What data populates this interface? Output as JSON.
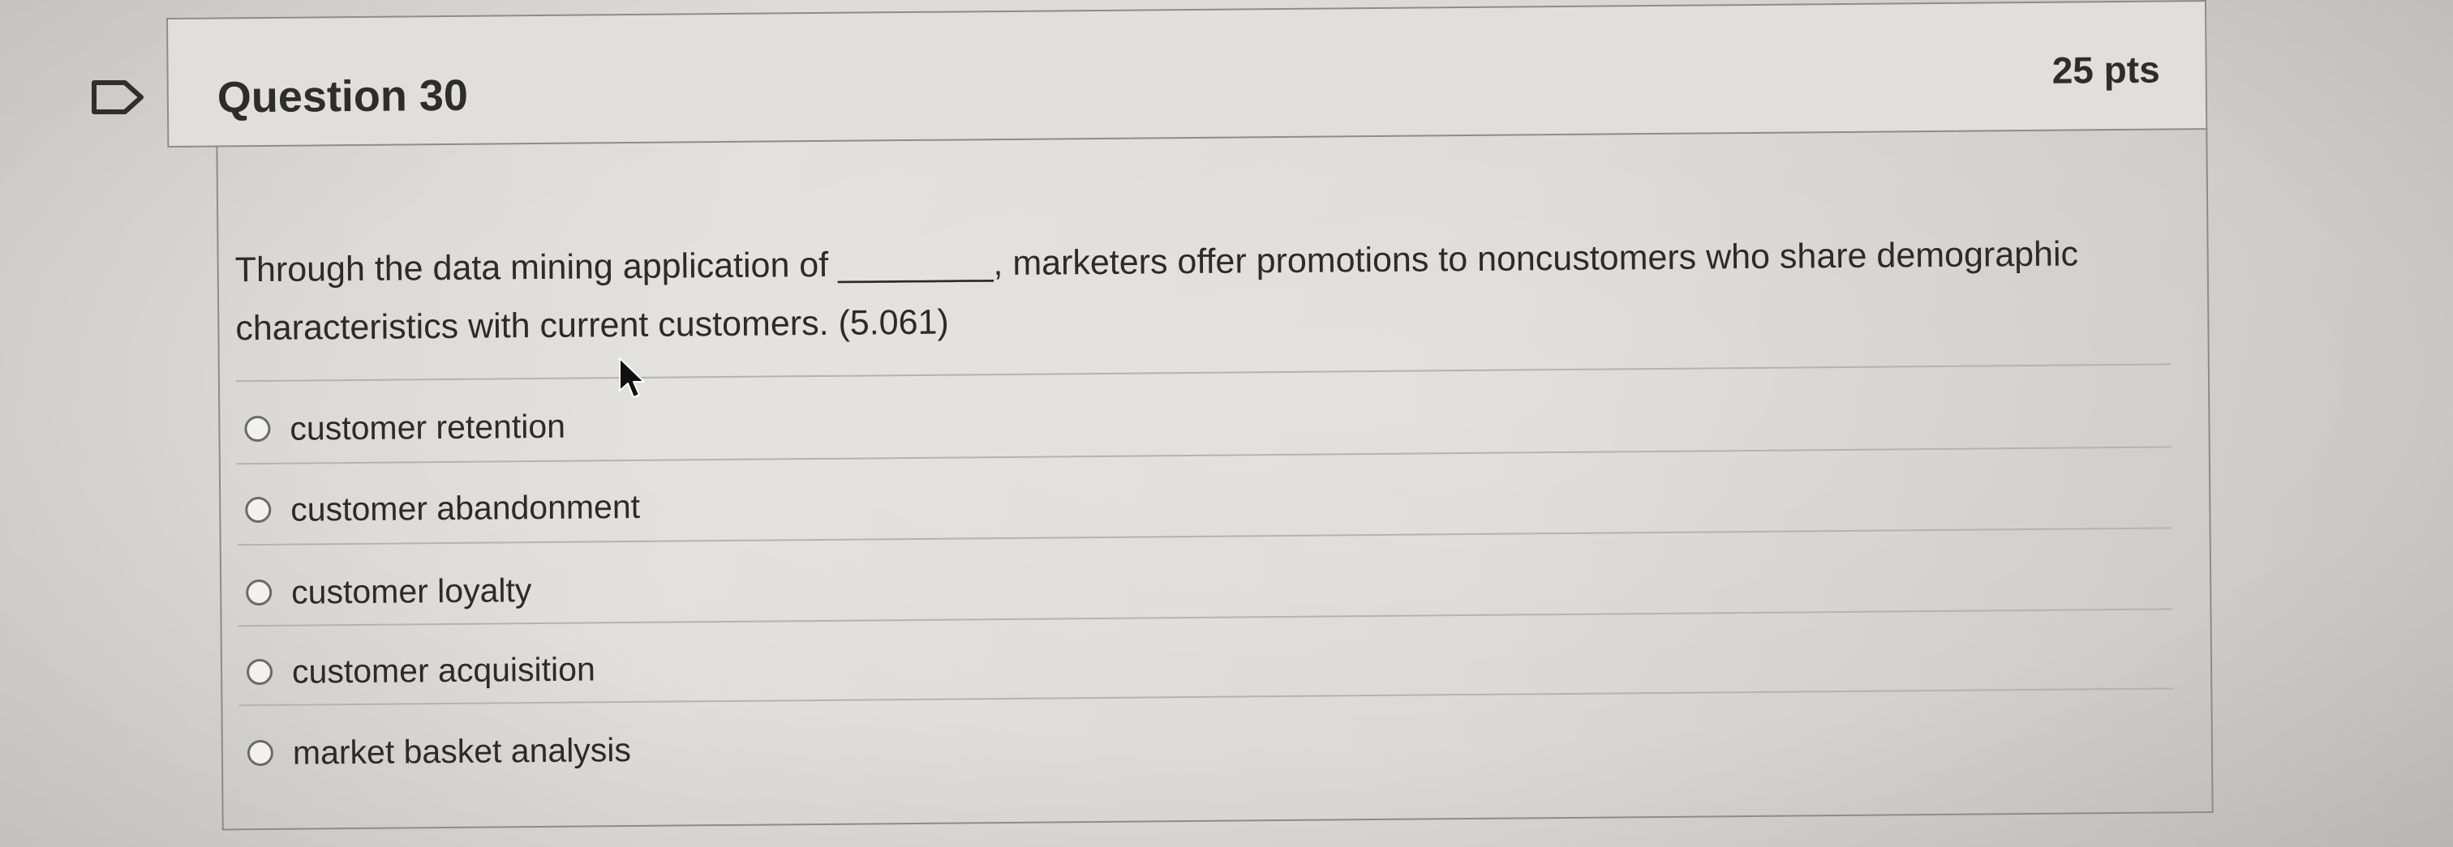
{
  "question": {
    "title": "Question 30",
    "points": "25 pts",
    "text": "Through the data mining application of ________, marketers offer promotions to noncustomers who share demographic characteristics with current customers. (5.061)"
  },
  "answers": [
    {
      "label": "customer retention",
      "selected": false
    },
    {
      "label": "customer abandonment",
      "selected": false
    },
    {
      "label": "customer loyalty",
      "selected": false
    },
    {
      "label": "customer acquisition",
      "selected": false
    },
    {
      "label": "market basket analysis",
      "selected": false
    }
  ],
  "icons": {
    "flag": "flag-icon",
    "cursor": "mouse-pointer-icon"
  },
  "colors": {
    "card_header_bg": "#e0dfdd",
    "border": "#8d8c8a",
    "text": "#2b2b2b"
  }
}
